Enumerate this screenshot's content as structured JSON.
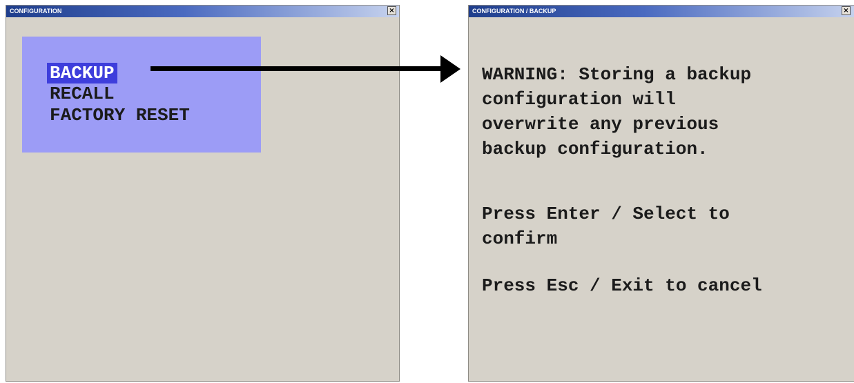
{
  "left_window": {
    "title": "CONFIGURATION",
    "close_label": "×",
    "menu": {
      "items": [
        {
          "label": "BACKUP",
          "selected": true
        },
        {
          "label": "RECALL",
          "selected": false
        },
        {
          "label": "FACTORY RESET",
          "selected": false
        }
      ]
    }
  },
  "right_window": {
    "title": "CONFIGURATION / BACKUP",
    "close_label": "×",
    "warning": "WARNING: Storing a backup\nconfiguration will\noverwrite any previous\nbackup configuration.",
    "confirm_hint": "Press Enter / Select to\nconfirm",
    "cancel_hint": "Press Esc / Exit to cancel"
  },
  "colors": {
    "window_background": "#d6d2c9",
    "menu_background": "#9c9cf6",
    "selected_item_background": "#3e3edc",
    "titlebar_start": "#1f3e8c",
    "titlebar_end": "#c7d3ee"
  },
  "icons": {
    "arrow": "right-arrow-icon",
    "close": "close-icon"
  }
}
